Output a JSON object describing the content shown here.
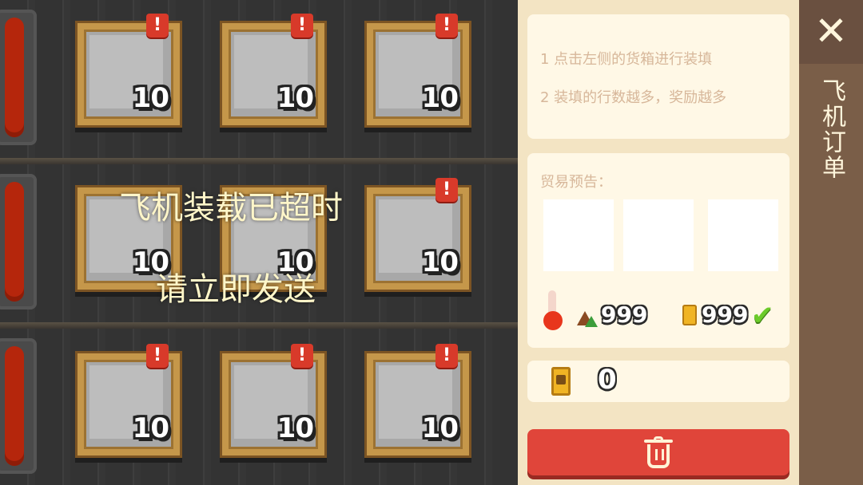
{
  "overlay": {
    "line1": "飞机装载已超时",
    "line2": "请立即发送"
  },
  "crates": [
    {
      "count": "10",
      "alert": "!"
    },
    {
      "count": "10",
      "alert": "!"
    },
    {
      "count": "10",
      "alert": "!"
    },
    {
      "count": "10",
      "alert": ""
    },
    {
      "count": "10",
      "alert": ""
    },
    {
      "count": "10",
      "alert": "!"
    },
    {
      "count": "10",
      "alert": "!"
    },
    {
      "count": "10",
      "alert": "!"
    },
    {
      "count": "10",
      "alert": "!"
    }
  ],
  "panel": {
    "instructions": [
      "1 点击左侧的货箱进行装填",
      "2 装填的行数越多，奖励越多"
    ],
    "forecast_label": "贸易预告：",
    "ore_amount": "999",
    "fuel_amount": "999",
    "reward_amount": "0"
  },
  "tab": {
    "close_symbol": "✕",
    "title": "飞机订单"
  },
  "colors": {
    "discard_button": "#e0453a",
    "tab_bg": "#7a5e48",
    "panel_bg": "#f3e4c3",
    "overlay_text": "#fff6c9"
  }
}
